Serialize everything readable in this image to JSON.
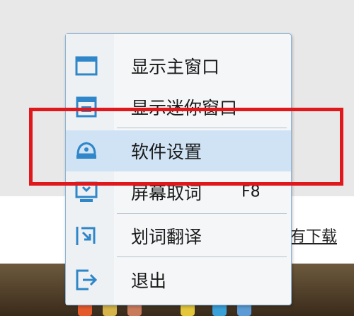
{
  "background": {
    "link_text": "有下载"
  },
  "menu": {
    "items": [
      {
        "label": "显示主窗口",
        "shortcut": "",
        "icon": "main-window-icon"
      },
      {
        "label": "显示迷你窗口",
        "shortcut": "",
        "icon": "mini-window-icon"
      },
      {
        "label": "软件设置",
        "shortcut": "",
        "icon": "settings-icon"
      },
      {
        "label": "屏幕取词",
        "shortcut": "F8",
        "icon": "screen-capture-icon"
      },
      {
        "label": "划词翻译",
        "shortcut": "",
        "icon": "select-translate-icon"
      },
      {
        "label": "退出",
        "shortcut": "",
        "icon": "exit-icon"
      }
    ]
  },
  "colors": {
    "accent": "#2f86c8",
    "highlight_row": "#cfe3f5",
    "annotation_box": "#e0171b"
  }
}
